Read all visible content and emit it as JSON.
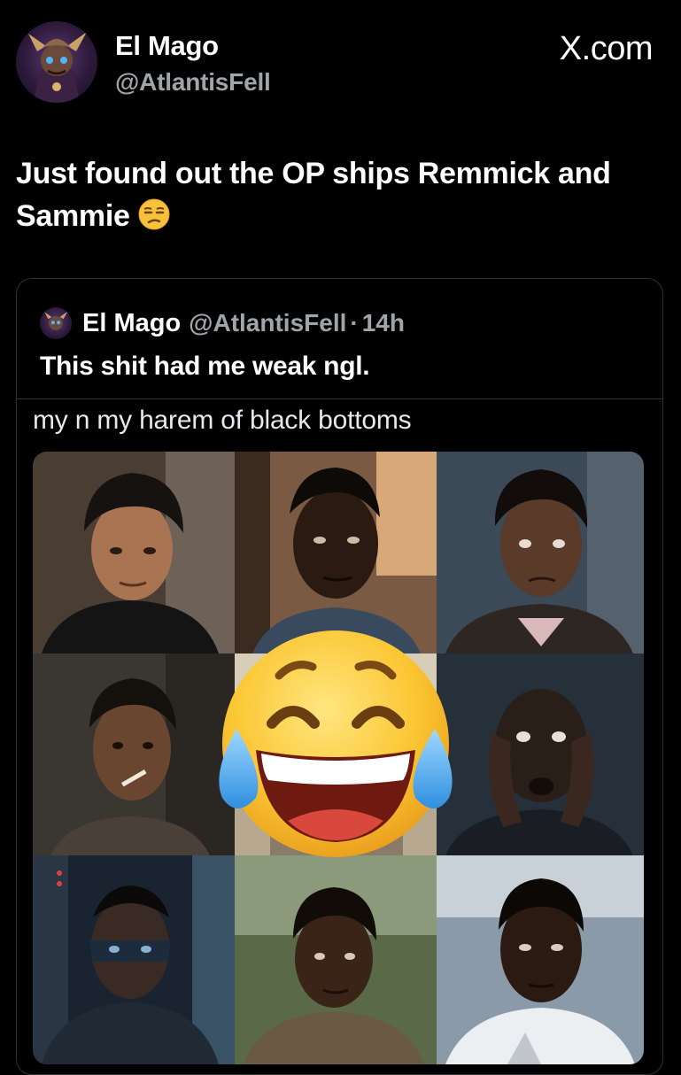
{
  "post": {
    "display_name": "El Mago",
    "handle": "@AtlantisFell",
    "site_label": "X.com",
    "text": "Just found out the OP ships Remmick and Sammie",
    "text_emoji": "unamused-face-emoji"
  },
  "quoted_post": {
    "display_name": "El Mago",
    "handle": "@AtlantisFell",
    "separator": "·",
    "time": "14h",
    "text": "This shit had me weak ngl.",
    "meme_caption": "my n my harem of black bottoms"
  },
  "photo_grid": {
    "rows": 3,
    "columns": 3,
    "overlay_emoji": "face-with-tears-of-joy-emoji"
  },
  "colors": {
    "background": "#000000",
    "primary_text": "#ffffff",
    "secondary_text": "#a0a5aa",
    "border": "#2f3336"
  }
}
